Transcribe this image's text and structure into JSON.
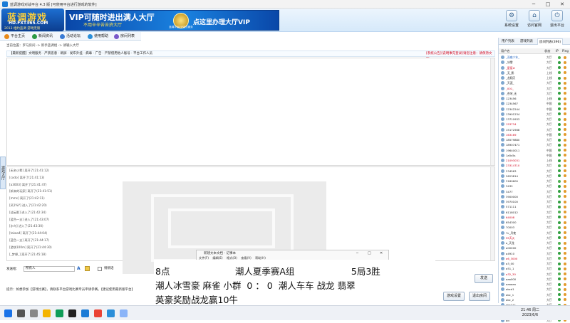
{
  "window": {
    "title": "蓝调游戏对战平台 4.3 版 [可使用平台进行游戏的软件]"
  },
  "banner": {
    "logo_main": "蓝调游戏",
    "logo_url": "HD.FXT365.COM",
    "logo_slogan": "2013 相约蓝调 游戏无限",
    "ad_line1": "VIP可随时进出满人大厅",
    "ad_line2": "不用辛辛苦苦挤大厅",
    "ad_line3": "点这里办理大厅VIP",
    "ad_crest_label": "蓝调平台VIP会员服务",
    "tools": [
      {
        "icon": "gear",
        "label": "系统设置"
      },
      {
        "icon": "home",
        "label": "访问官网"
      },
      {
        "icon": "exit",
        "label": "退出平台"
      }
    ]
  },
  "nav": {
    "items": [
      "平台主页",
      "新闻资讯",
      "活动论坛",
      "使用帮助",
      "房间列表"
    ]
  },
  "breadcrumb": "当前位置：罗马房间 -> 新手蓝调组 -> 请输入大厅",
  "notice": {
    "left": "【最新提醒】文明服务 · 严禁恶意 · 刷屏 · 发布外挂 · 病毒 · 广告 · 严禁借用他人账号 · 平台工作人员",
    "right": "[系统公告][说明事先登录]请您注意：请保持文明"
  },
  "side_tab": "游戏大厅",
  "join_log": [
    "[无名小辈] 离开了(21:41:12)",
    "[cxdo] 离开了(21:41:13)",
    "[a3003] 离开了(21:41:47)",
    "[新来的玩家] 离开了(21:41:51)",
    "[mms] 离开了(21:42:11)",
    "[风1%Y] 进入了(21:42:20)",
    "[战云影] 进入了(21:42:34)",
    "[蓝色一支] 进入了(21:43:07)",
    "[水鸟] 进入了(21:43:30)",
    "[taiwa4] 离开了(21:44:04)",
    "[蓝色一支] 离开了(21:44:17)",
    "[游侠100m] 离开了(21:44:30)",
    "[_梦想_] 离开了(21:45:18)"
  ],
  "input_row": {
    "label": "发送给：",
    "target": "所有人",
    "checkbox": "悄悄话"
  },
  "tips": "提示：如想参加【游戏比赛】，请联系平台游戏比赛专员申请参赛。【建议使用最新版平台】",
  "buttons": {
    "send": "发送",
    "room_settings": "游戏设置",
    "exit_room": "退出房间"
  },
  "right_panel": {
    "tabs": [
      "用户列表",
      "游戏列表",
      "房间列表(396)"
    ],
    "columns": [
      "用户名",
      "状态",
      "IP",
      "Ping"
    ],
    "users": [
      {
        "name": "_深夜少年_",
        "status": "大厅",
        "color": "#1b5fbf"
      },
      {
        "name": "_冰雪",
        "status": "大厅",
        "color": "#222"
      },
      {
        "name": "_星辰★",
        "status": "大厅",
        "color": "#d0021b"
      },
      {
        "name": "_无_影",
        "status": "上线",
        "color": "#222"
      },
      {
        "name": "_龙翔天",
        "status": "上线",
        "color": "#222"
      },
      {
        "name": "_天涯_",
        "status": "大厅",
        "color": "#222"
      },
      {
        "name": "_001_",
        "status": "大厅",
        "color": "#d0021b"
      },
      {
        "name": "_苍穹_无",
        "status": "大厅",
        "color": "#222"
      },
      {
        "name": "123456",
        "status": "上线",
        "color": "#222"
      },
      {
        "name": "1234567",
        "status": "中国",
        "color": "#222"
      },
      {
        "name": "12342244",
        "status": "中国",
        "color": "#222"
      },
      {
        "name": "13901234",
        "status": "大厅",
        "color": "#222"
      },
      {
        "name": "13710933",
        "status": "大厅",
        "color": "#222"
      },
      {
        "name": "153734",
        "status": "大厅",
        "color": "#d0021b"
      },
      {
        "name": "15172568",
        "status": "大厅",
        "color": "#222"
      },
      {
        "name": "163169",
        "status": "中国",
        "color": "#d0021b"
      },
      {
        "name": "18579880",
        "status": "大厅",
        "color": "#222"
      },
      {
        "name": "18907471",
        "status": "大厅",
        "color": "#222"
      },
      {
        "name": "19640011",
        "status": "中国",
        "color": "#222"
      },
      {
        "name": "1a5s5s",
        "status": "中国",
        "color": "#222"
      },
      {
        "name": "21093031",
        "status": "上线",
        "color": "#d0021b"
      },
      {
        "name": "23314710",
        "status": "大厅",
        "color": "#d0021b"
      },
      {
        "name": "234563",
        "status": "大厅",
        "color": "#222"
      },
      {
        "name": "2623814",
        "status": "大厅",
        "color": "#222"
      },
      {
        "name": "3180600",
        "status": "大厅",
        "color": "#222"
      },
      {
        "name": "3432",
        "status": "大厅",
        "color": "#222"
      },
      {
        "name": "3477",
        "status": "大厅",
        "color": "#222"
      },
      {
        "name": "3900000",
        "status": "大厅",
        "color": "#222"
      },
      {
        "name": "3970100",
        "status": "大厅",
        "color": "#222"
      },
      {
        "name": "571111",
        "status": "大厅",
        "color": "#222"
      },
      {
        "name": "6118012",
        "status": "大厅",
        "color": "#222"
      },
      {
        "name": "64008",
        "status": "大厅",
        "color": "#d0021b"
      },
      {
        "name": "654300",
        "status": "大厅",
        "color": "#222"
      },
      {
        "name": "70003",
        "status": "大厅",
        "color": "#222"
      },
      {
        "name": "7c_月夜",
        "status": "大厅",
        "color": "#222"
      },
      {
        "name": "95天火",
        "status": "大厅",
        "color": "#d0021b"
      },
      {
        "name": "a_天龙",
        "status": "大厅",
        "color": "#222"
      },
      {
        "name": "a00000",
        "status": "大厅",
        "color": "#222"
      },
      {
        "name": "a4910",
        "status": "大厅",
        "color": "#222"
      },
      {
        "name": "a6_3000",
        "status": "大厅",
        "color": "#d0021b"
      },
      {
        "name": "a3_00",
        "status": "大厅",
        "color": "#222"
      },
      {
        "name": "a51_1",
        "status": "大厅",
        "color": "#222"
      },
      {
        "name": "a32_30",
        "status": "大厅",
        "color": "#d0021b"
      },
      {
        "name": "aaa000",
        "status": "大厅",
        "color": "#222"
      },
      {
        "name": "aaaaaa",
        "status": "大厅",
        "color": "#222"
      },
      {
        "name": "abcd1",
        "status": "大厅",
        "color": "#222"
      },
      {
        "name": "abc_1",
        "status": "大厅",
        "color": "#222"
      },
      {
        "name": "abc_2",
        "status": "大厅",
        "color": "#222"
      },
      {
        "name": "abc211",
        "status": "大厅",
        "color": "#222"
      },
      {
        "name": "abc12",
        "status": "大厅",
        "color": "#222"
      },
      {
        "name": "ace",
        "status": "大厅",
        "color": "#222"
      },
      {
        "name": "ad",
        "status": "大厅",
        "color": "#222"
      }
    ]
  },
  "notepad": {
    "title": "新建文本文档 - 记事本",
    "menu": "文件(F) 编辑(E) 格式(O) 查看(V) 帮助(H)",
    "lines": [
      "8点                       潮人夏季赛A组                    5局3胜",
      "潮人冰雪豪 麻雀 小群  0 ： 0  潮人车车 战龙 翡翠",
      "英豪奖励战龙赢10牛"
    ]
  },
  "taskbar": {
    "time": "21:46 周二",
    "date": "2023/6/6"
  }
}
